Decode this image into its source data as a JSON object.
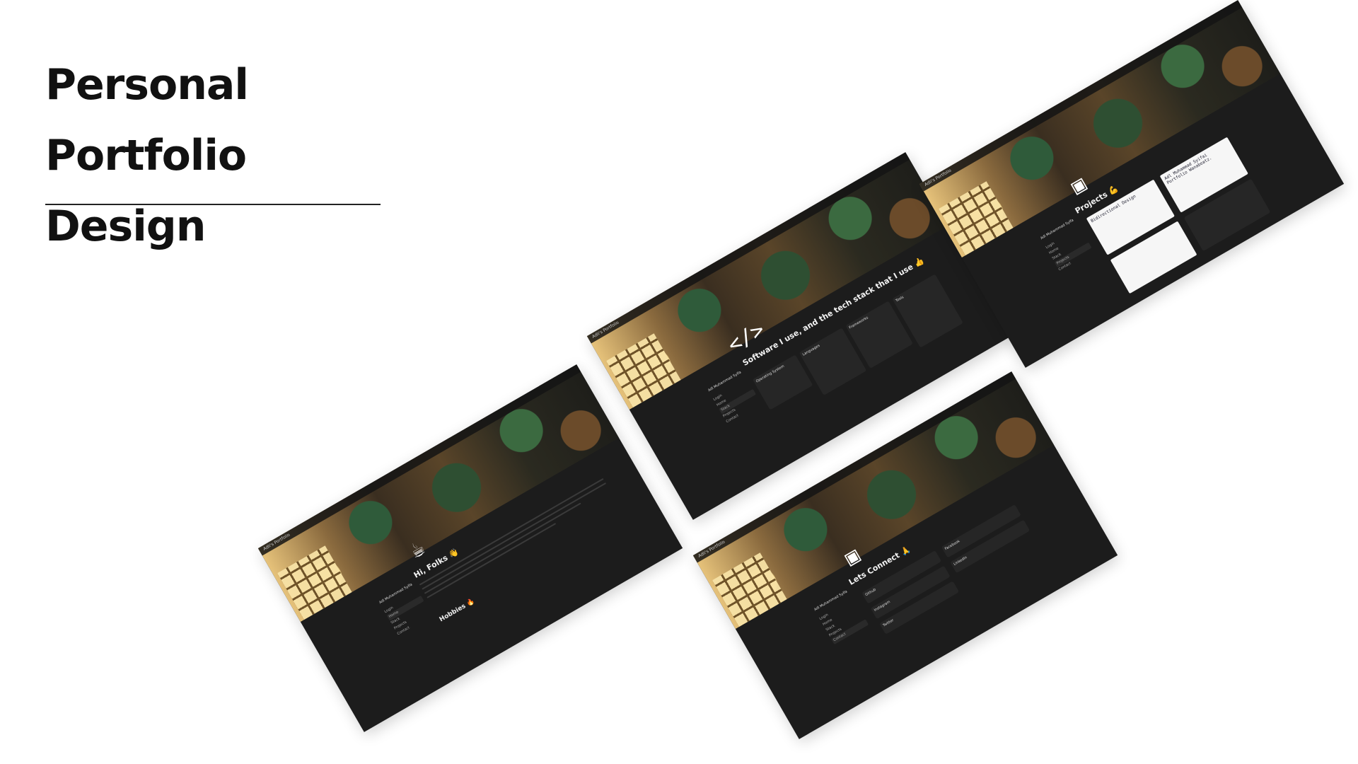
{
  "heading": {
    "line1": "Personal Portfolio",
    "line2": "Design"
  },
  "cards": {
    "home": {
      "topbar": "Adli's Portfolio",
      "title": "Hi, Folks 👋",
      "subheading": "Hobbies 🔥",
      "icon": "coffee-cup-icon",
      "sidebar": {
        "name": "Adl Muhammad Syifa",
        "items": [
          "Login",
          "Home",
          "Stack",
          "Projects",
          "Contact"
        ]
      }
    },
    "stack": {
      "topbar": "Adli's Portfolio",
      "title": "Software I use, and the tech stack that I use 👍",
      "icon": "code-brackets-icon",
      "glyph": "</>",
      "panels": [
        "Operating System",
        "Languages",
        "Frameworks",
        "Tools"
      ],
      "sidebar": {
        "name": "Adl Muhammad Syifa",
        "items": [
          "Login",
          "Home",
          "Stack",
          "Projects",
          "Contact"
        ]
      }
    },
    "projects": {
      "topbar": "Adli's Portfolio",
      "title": "Projects 💪",
      "icon": "portrait-frame-icon",
      "thumbs": [
        "Adl Muhammad Syifai Portfolio Wanabeatz.",
        "Bidirectional Design"
      ],
      "sidebar": {
        "name": "Adl Muhammad Syifa",
        "items": [
          "Login",
          "Home",
          "Stack",
          "Projects",
          "Contact"
        ]
      }
    },
    "connect": {
      "topbar": "Adli's Portfolio",
      "title": "Lets Connect 🙏",
      "icon": "portrait-frame-icon",
      "links": [
        "Github",
        "Facebook",
        "Instagram",
        "LinkedIn",
        "Twitter"
      ],
      "sidebar": {
        "name": "Adl Muhammad Syifa",
        "items": [
          "Login",
          "Home",
          "Stack",
          "Projects",
          "Contact"
        ]
      }
    }
  }
}
